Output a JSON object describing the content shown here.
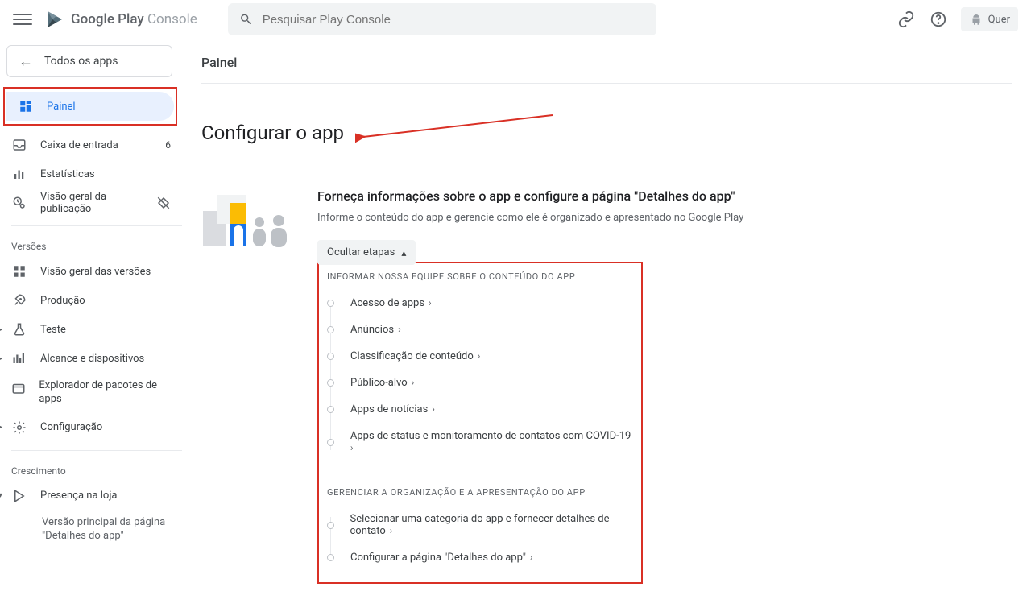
{
  "brand": {
    "name1": "Google Play",
    "name2": " Console"
  },
  "search": {
    "placeholder": "Pesquisar Play Console"
  },
  "top_chip": "Quer",
  "back_all": "Todos os apps",
  "nav": {
    "painel": "Painel",
    "inbox": "Caixa de entrada",
    "inbox_badge": "6",
    "stats": "Estatísticas",
    "pub_overview": "Visão geral da publicação"
  },
  "sections": {
    "versoes": "Versões",
    "crescimento": "Crescimento"
  },
  "versoes_items": {
    "overview": "Visão geral das versões",
    "prod": "Produção",
    "test": "Teste",
    "reach": "Alcance e dispositivos",
    "explorer": "Explorador de pacotes de apps",
    "config": "Configuração"
  },
  "cresc_items": {
    "store": "Presença na loja",
    "store_sub": "Versão principal da página \"Detalhes do app\""
  },
  "page": {
    "title_small": "Painel",
    "heading": "Configurar o app",
    "subheading": "Forneça informações sobre o app e configure a página \"Detalhes do app\"",
    "desc": "Informe o conteúdo do app e gerencie como ele é organizado e apresentado no Google Play",
    "hide": "Ocultar etapas"
  },
  "groups": {
    "g1": "Informar nossa equipe sobre o conteúdo do app",
    "g2": "Gerenciar a organização e a apresentação do app"
  },
  "steps1": [
    "Acesso de apps",
    "Anúncios",
    "Classificação de conteúdo",
    "Público-alvo",
    "Apps de notícias",
    "Apps de status e monitoramento de contatos com COVID-19"
  ],
  "steps2": [
    "Selecionar uma categoria do app e fornecer detalhes de contato",
    "Configurar a página \"Detalhes do app\""
  ]
}
